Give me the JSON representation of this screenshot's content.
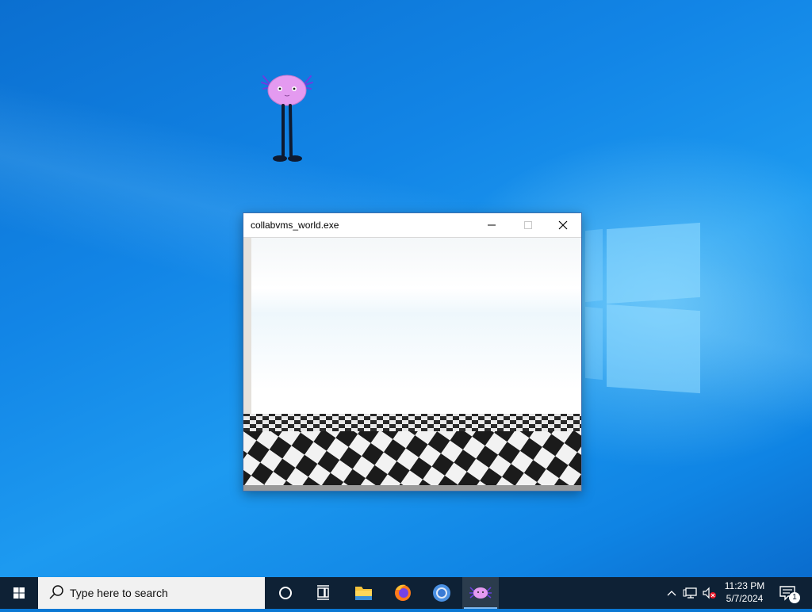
{
  "window": {
    "title": "collabvms_world.exe"
  },
  "taskbar": {
    "search_placeholder": "Type here to search",
    "pinned": [
      "cortana-icon",
      "task-view-icon",
      "file-explorer-icon",
      "firefox-icon",
      "chrome-icon",
      "axolotl-app-icon"
    ],
    "active_app": "axolotl-app-icon"
  },
  "tray": {
    "time": "11:23 PM",
    "date": "5/7/2024",
    "notification_count": "1",
    "volume_muted": true
  },
  "colors": {
    "desktop_accent": "#0a78d4",
    "taskbar": "#0e2135",
    "creature_body": "#e49af0",
    "creature_spikes": "#6a3ee0"
  }
}
